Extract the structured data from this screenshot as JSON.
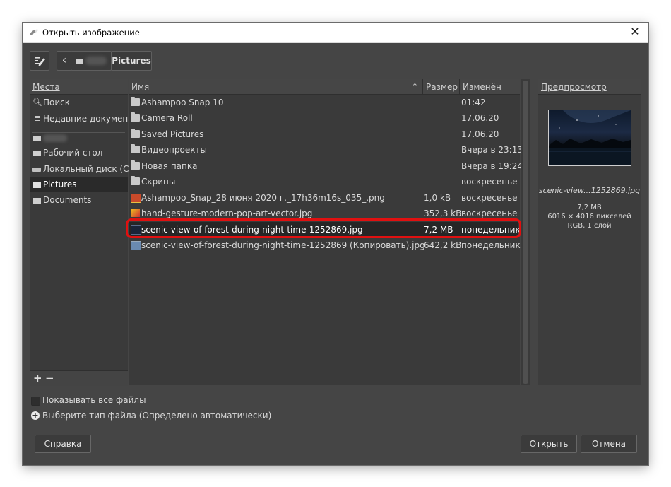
{
  "window": {
    "title": "Открыть изображение",
    "close_glyph": "✕"
  },
  "toolbar": {
    "edit_icon": "edit-location-icon",
    "back_glyph": "‹",
    "path_current": "Pictures"
  },
  "places": {
    "header": "Места",
    "items": [
      {
        "label": "Поиск",
        "icon": "search-icon"
      },
      {
        "label": "Недавние докумен...",
        "icon": "recent-icon"
      },
      {
        "label": "",
        "icon": "folder-icon"
      },
      {
        "label": "Рабочий стол",
        "icon": "folder-icon"
      },
      {
        "label": "Локальный диск (C:)",
        "icon": "drive-icon"
      },
      {
        "label": "Pictures",
        "icon": "folder-icon"
      },
      {
        "label": "Documents",
        "icon": "folder-icon"
      }
    ],
    "add_glyph": "+",
    "remove_glyph": "−"
  },
  "files": {
    "col_name": "Имя",
    "col_size": "Размер",
    "col_modified": "Изменён",
    "rows": [
      {
        "name": "Ashampoo Snap 10",
        "size": "",
        "modified": "01:42",
        "type": "folder"
      },
      {
        "name": "Camera Roll",
        "size": "",
        "modified": "17.06.20",
        "type": "folder"
      },
      {
        "name": "Saved Pictures",
        "size": "",
        "modified": "17.06.20",
        "type": "folder"
      },
      {
        "name": "Видеопроекты",
        "size": "",
        "modified": "Вчера в 23:13",
        "type": "folder"
      },
      {
        "name": "Новая папка",
        "size": "",
        "modified": "Вчера в 19:24",
        "type": "folder"
      },
      {
        "name": "Скрины",
        "size": "",
        "modified": "воскресенье",
        "type": "folder"
      },
      {
        "name": "Ashampoo_Snap_28 июня 2020 г._17h36m16s_035_.png",
        "size": "1,0 kB",
        "modified": "воскресенье",
        "type": "image"
      },
      {
        "name": "hand-gesture-modern-pop-art-vector.jpg",
        "size": "352,3 kB",
        "modified": "воскресенье",
        "type": "image"
      },
      {
        "name": "scenic-view-of-forest-during-night-time-1252869.jpg",
        "size": "7,2 MB",
        "modified": "понедельник",
        "type": "image"
      },
      {
        "name": "scenic-view-of-forest-during-night-time-1252869 (Копировать).jpg",
        "size": "642,2 kB",
        "modified": "понедельник",
        "type": "image"
      }
    ],
    "selected_index": 8
  },
  "preview": {
    "header": "Предпросмотр",
    "filename": "scenic-view...1252869.jpg",
    "size": "7,2 MB",
    "dimensions": "6016 × 4016 пикселей",
    "mode": "RGB, 1 слой"
  },
  "options": {
    "show_all_files": "Показывать все файлы",
    "file_type": "Выберите тип файла (Определено автоматически)"
  },
  "buttons": {
    "help": "Справка",
    "open": "Открыть",
    "cancel": "Отмена"
  },
  "colors": {
    "highlight_outline": "#e01010",
    "selection_bg": "#262626"
  }
}
